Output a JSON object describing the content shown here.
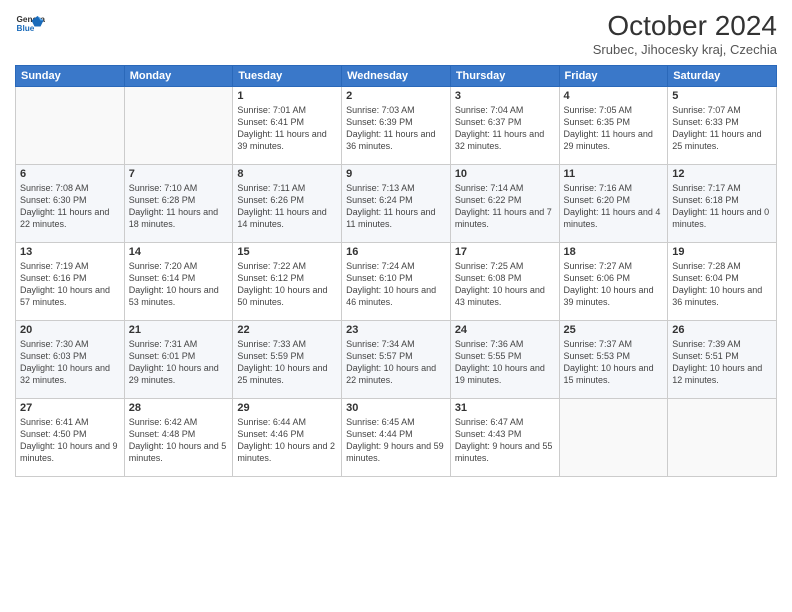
{
  "header": {
    "logo_general": "General",
    "logo_blue": "Blue",
    "month": "October 2024",
    "location": "Srubec, Jihocesky kraj, Czechia"
  },
  "weekdays": [
    "Sunday",
    "Monday",
    "Tuesday",
    "Wednesday",
    "Thursday",
    "Friday",
    "Saturday"
  ],
  "weeks": [
    [
      {
        "day": "",
        "content": ""
      },
      {
        "day": "",
        "content": ""
      },
      {
        "day": "1",
        "content": "Sunrise: 7:01 AM\nSunset: 6:41 PM\nDaylight: 11 hours and 39 minutes."
      },
      {
        "day": "2",
        "content": "Sunrise: 7:03 AM\nSunset: 6:39 PM\nDaylight: 11 hours and 36 minutes."
      },
      {
        "day": "3",
        "content": "Sunrise: 7:04 AM\nSunset: 6:37 PM\nDaylight: 11 hours and 32 minutes."
      },
      {
        "day": "4",
        "content": "Sunrise: 7:05 AM\nSunset: 6:35 PM\nDaylight: 11 hours and 29 minutes."
      },
      {
        "day": "5",
        "content": "Sunrise: 7:07 AM\nSunset: 6:33 PM\nDaylight: 11 hours and 25 minutes."
      }
    ],
    [
      {
        "day": "6",
        "content": "Sunrise: 7:08 AM\nSunset: 6:30 PM\nDaylight: 11 hours and 22 minutes."
      },
      {
        "day": "7",
        "content": "Sunrise: 7:10 AM\nSunset: 6:28 PM\nDaylight: 11 hours and 18 minutes."
      },
      {
        "day": "8",
        "content": "Sunrise: 7:11 AM\nSunset: 6:26 PM\nDaylight: 11 hours and 14 minutes."
      },
      {
        "day": "9",
        "content": "Sunrise: 7:13 AM\nSunset: 6:24 PM\nDaylight: 11 hours and 11 minutes."
      },
      {
        "day": "10",
        "content": "Sunrise: 7:14 AM\nSunset: 6:22 PM\nDaylight: 11 hours and 7 minutes."
      },
      {
        "day": "11",
        "content": "Sunrise: 7:16 AM\nSunset: 6:20 PM\nDaylight: 11 hours and 4 minutes."
      },
      {
        "day": "12",
        "content": "Sunrise: 7:17 AM\nSunset: 6:18 PM\nDaylight: 11 hours and 0 minutes."
      }
    ],
    [
      {
        "day": "13",
        "content": "Sunrise: 7:19 AM\nSunset: 6:16 PM\nDaylight: 10 hours and 57 minutes."
      },
      {
        "day": "14",
        "content": "Sunrise: 7:20 AM\nSunset: 6:14 PM\nDaylight: 10 hours and 53 minutes."
      },
      {
        "day": "15",
        "content": "Sunrise: 7:22 AM\nSunset: 6:12 PM\nDaylight: 10 hours and 50 minutes."
      },
      {
        "day": "16",
        "content": "Sunrise: 7:24 AM\nSunset: 6:10 PM\nDaylight: 10 hours and 46 minutes."
      },
      {
        "day": "17",
        "content": "Sunrise: 7:25 AM\nSunset: 6:08 PM\nDaylight: 10 hours and 43 minutes."
      },
      {
        "day": "18",
        "content": "Sunrise: 7:27 AM\nSunset: 6:06 PM\nDaylight: 10 hours and 39 minutes."
      },
      {
        "day": "19",
        "content": "Sunrise: 7:28 AM\nSunset: 6:04 PM\nDaylight: 10 hours and 36 minutes."
      }
    ],
    [
      {
        "day": "20",
        "content": "Sunrise: 7:30 AM\nSunset: 6:03 PM\nDaylight: 10 hours and 32 minutes."
      },
      {
        "day": "21",
        "content": "Sunrise: 7:31 AM\nSunset: 6:01 PM\nDaylight: 10 hours and 29 minutes."
      },
      {
        "day": "22",
        "content": "Sunrise: 7:33 AM\nSunset: 5:59 PM\nDaylight: 10 hours and 25 minutes."
      },
      {
        "day": "23",
        "content": "Sunrise: 7:34 AM\nSunset: 5:57 PM\nDaylight: 10 hours and 22 minutes."
      },
      {
        "day": "24",
        "content": "Sunrise: 7:36 AM\nSunset: 5:55 PM\nDaylight: 10 hours and 19 minutes."
      },
      {
        "day": "25",
        "content": "Sunrise: 7:37 AM\nSunset: 5:53 PM\nDaylight: 10 hours and 15 minutes."
      },
      {
        "day": "26",
        "content": "Sunrise: 7:39 AM\nSunset: 5:51 PM\nDaylight: 10 hours and 12 minutes."
      }
    ],
    [
      {
        "day": "27",
        "content": "Sunrise: 6:41 AM\nSunset: 4:50 PM\nDaylight: 10 hours and 9 minutes."
      },
      {
        "day": "28",
        "content": "Sunrise: 6:42 AM\nSunset: 4:48 PM\nDaylight: 10 hours and 5 minutes."
      },
      {
        "day": "29",
        "content": "Sunrise: 6:44 AM\nSunset: 4:46 PM\nDaylight: 10 hours and 2 minutes."
      },
      {
        "day": "30",
        "content": "Sunrise: 6:45 AM\nSunset: 4:44 PM\nDaylight: 9 hours and 59 minutes."
      },
      {
        "day": "31",
        "content": "Sunrise: 6:47 AM\nSunset: 4:43 PM\nDaylight: 9 hours and 55 minutes."
      },
      {
        "day": "",
        "content": ""
      },
      {
        "day": "",
        "content": ""
      }
    ]
  ]
}
